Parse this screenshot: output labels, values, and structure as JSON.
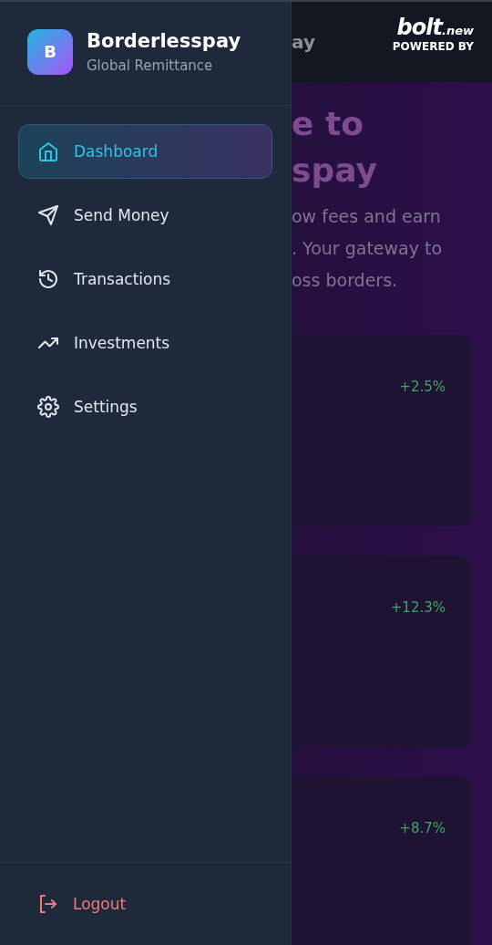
{
  "sidebar": {
    "brand": {
      "logo_letter": "B",
      "name": "Borderlesspay",
      "subtitle": "Global Remittance"
    },
    "nav": [
      {
        "label": "Dashboard",
        "kind": "home",
        "selected": true
      },
      {
        "label": "Send Money",
        "kind": "send",
        "selected": false
      },
      {
        "label": "Transactions",
        "kind": "history",
        "selected": false
      },
      {
        "label": "Investments",
        "kind": "trending",
        "selected": false
      },
      {
        "label": "Settings",
        "kind": "settings",
        "selected": false
      }
    ],
    "logout": "Logout"
  },
  "background": {
    "header_fragment": "ay",
    "badge": {
      "wordmark": "bolt",
      "suffix": ".new",
      "caption": "POWERED BY"
    },
    "hero_lines": [
      "e to",
      "spay"
    ],
    "intro_lines": [
      "ow fees and earn",
      ". Your gateway to",
      "oss borders."
    ],
    "cards": [
      {
        "change": "+2.5%"
      },
      {
        "change": "+12.3%"
      },
      {
        "change": "+8.7%"
      }
    ]
  }
}
